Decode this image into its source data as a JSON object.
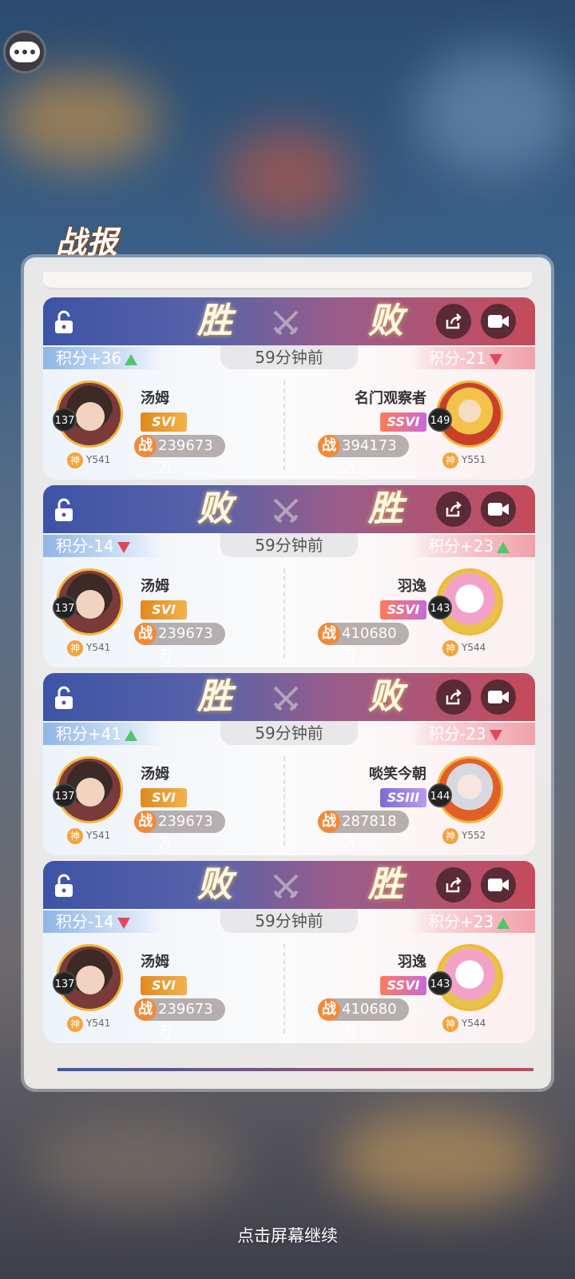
{
  "title": "战报",
  "continue_hint": "点击屏幕继续",
  "colors": {
    "win_side_blue": "#3c54a6",
    "lose_side_red": "#c64a5a",
    "accent_orange": "#f28a3a"
  },
  "records": [
    {
      "left_result": "胜",
      "right_result": "败",
      "time": "59分钟前",
      "left_score": "积分+36",
      "left_trend": "up",
      "right_score": "积分-21",
      "right_trend": "down",
      "left": {
        "name": "汤姆",
        "level": "137",
        "god": "神",
        "server": "Y541",
        "rank": "SVI",
        "power_label": "战",
        "power": "239673万"
      },
      "right": {
        "name": "名门观察者",
        "level": "149",
        "god": "神",
        "server": "Y551",
        "rank": "SSVI",
        "power_label": "战",
        "power": "394173万"
      }
    },
    {
      "left_result": "败",
      "right_result": "胜",
      "time": "59分钟前",
      "left_score": "积分-14",
      "left_trend": "down",
      "right_score": "积分+23",
      "right_trend": "up",
      "left": {
        "name": "汤姆",
        "level": "137",
        "god": "神",
        "server": "Y541",
        "rank": "SVI",
        "power_label": "战",
        "power": "239673万"
      },
      "right": {
        "name": "羽逸",
        "level": "143",
        "god": "神",
        "server": "Y544",
        "rank": "SSVI",
        "power_label": "战",
        "power": "410680万"
      }
    },
    {
      "left_result": "胜",
      "right_result": "败",
      "time": "59分钟前",
      "left_score": "积分+41",
      "left_trend": "up",
      "right_score": "积分-23",
      "right_trend": "down",
      "left": {
        "name": "汤姆",
        "level": "137",
        "god": "神",
        "server": "Y541",
        "rank": "SVI",
        "power_label": "战",
        "power": "239673万"
      },
      "right": {
        "name": "啖笑今朝",
        "level": "144",
        "god": "神",
        "server": "Y552",
        "rank": "SSIII",
        "power_label": "战",
        "power": "287818万"
      }
    },
    {
      "left_result": "败",
      "right_result": "胜",
      "time": "59分钟前",
      "left_score": "积分-14",
      "left_trend": "down",
      "right_score": "积分+23",
      "right_trend": "up",
      "left": {
        "name": "汤姆",
        "level": "137",
        "god": "神",
        "server": "Y541",
        "rank": "SVI",
        "power_label": "战",
        "power": "239673万"
      },
      "right": {
        "name": "羽逸",
        "level": "143",
        "god": "神",
        "server": "Y544",
        "rank": "SSVI",
        "power_label": "战",
        "power": "410680万"
      }
    }
  ]
}
